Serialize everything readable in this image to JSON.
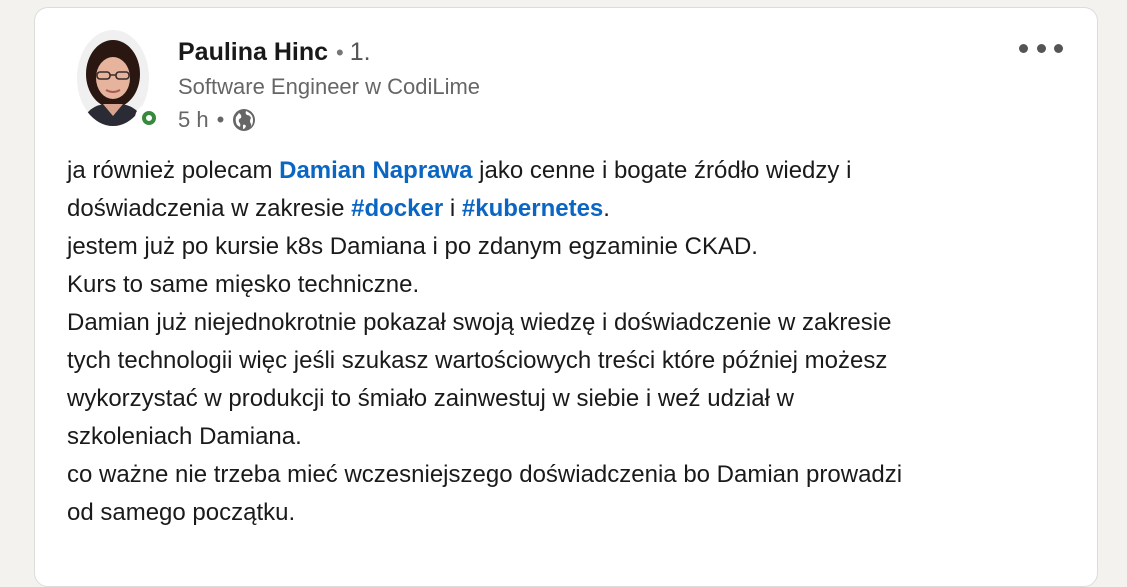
{
  "post": {
    "author": {
      "name": "Paulina Hinc",
      "separator": "•",
      "degree": "1.",
      "headline": "Software Engineer w CodiLime"
    },
    "time": "5 h",
    "meta_separator": "•",
    "icons": {
      "visibility": "globe-icon",
      "more": "ellipsis-icon",
      "presence": "online-status-icon"
    },
    "colors": {
      "link": "#0a66c2",
      "presence": "#378a3d"
    },
    "body": {
      "line1_a": "ja również polecam ",
      "mention_1": "Damian Naprawa",
      "line1_b": " jako cenne i bogate źródło wiedzy i",
      "line2_a": "doświadczenia w zakresie ",
      "hashtag_1": "#docker",
      "line2_b": " i ",
      "hashtag_2": "#kubernetes",
      "line2_c": ".",
      "line3": "jestem już po kursie k8s Damiana i po zdanym egzaminie CKAD.",
      "line4": "Kurs to same mięsko techniczne.",
      "line5": "Damian już niejednokrotnie pokazał swoją wiedzę i doświadczenie w zakresie",
      "line6": "tych technologii więc jeśli szukasz wartościowych treści które później możesz",
      "line7": "wykorzystać w produkcji to śmiało zainwestuj w siebie i weź udział w",
      "line8": "szkoleniach Damiana.",
      "line9": "co ważne nie trzeba mieć wczesniejszego doświadczenia bo Damian prowadzi",
      "line10": "od samego początku."
    }
  }
}
